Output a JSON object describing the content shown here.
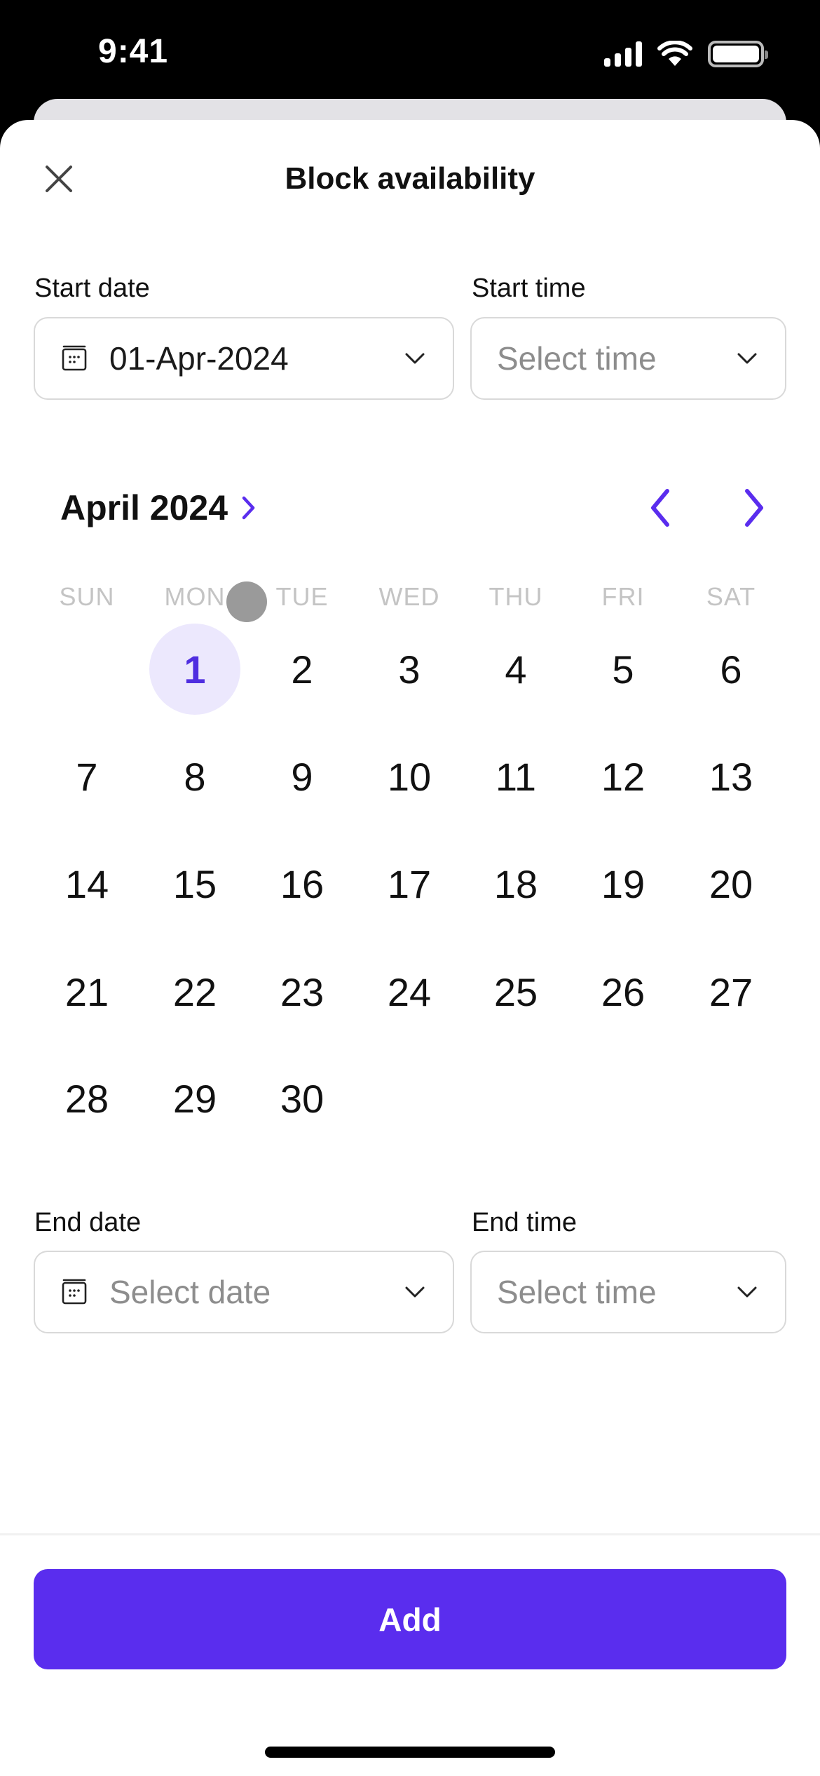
{
  "status_bar": {
    "time": "9:41",
    "icons": [
      "signal-icon",
      "wifi-icon",
      "battery-icon"
    ]
  },
  "header": {
    "title": "Block availability",
    "close_icon": "close-icon"
  },
  "start": {
    "date_label": "Start date",
    "date_value": "01-Apr-2024",
    "time_label": "Start time",
    "time_placeholder": "Select time"
  },
  "calendar": {
    "month_title": "April 2024",
    "weekdays": [
      "SUN",
      "MON",
      "TUE",
      "WED",
      "THU",
      "FRI",
      "SAT"
    ],
    "first_weekday_index": 1,
    "days_in_month": 30,
    "selected_day": 1,
    "days": [
      "1",
      "2",
      "3",
      "4",
      "5",
      "6",
      "7",
      "8",
      "9",
      "10",
      "11",
      "12",
      "13",
      "14",
      "15",
      "16",
      "17",
      "18",
      "19",
      "20",
      "21",
      "22",
      "23",
      "24",
      "25",
      "26",
      "27",
      "28",
      "29",
      "30"
    ]
  },
  "end": {
    "date_label": "End date",
    "date_placeholder": "Select date",
    "time_label": "End time",
    "time_placeholder": "Select time"
  },
  "footer": {
    "add_label": "Add"
  },
  "colors": {
    "accent": "#5a2dee",
    "selected_day_bg": "#ece8fd",
    "selected_day_text": "#4f2ee0",
    "weekday_text": "#c4c4c4",
    "placeholder_text": "#8d8d8d"
  }
}
